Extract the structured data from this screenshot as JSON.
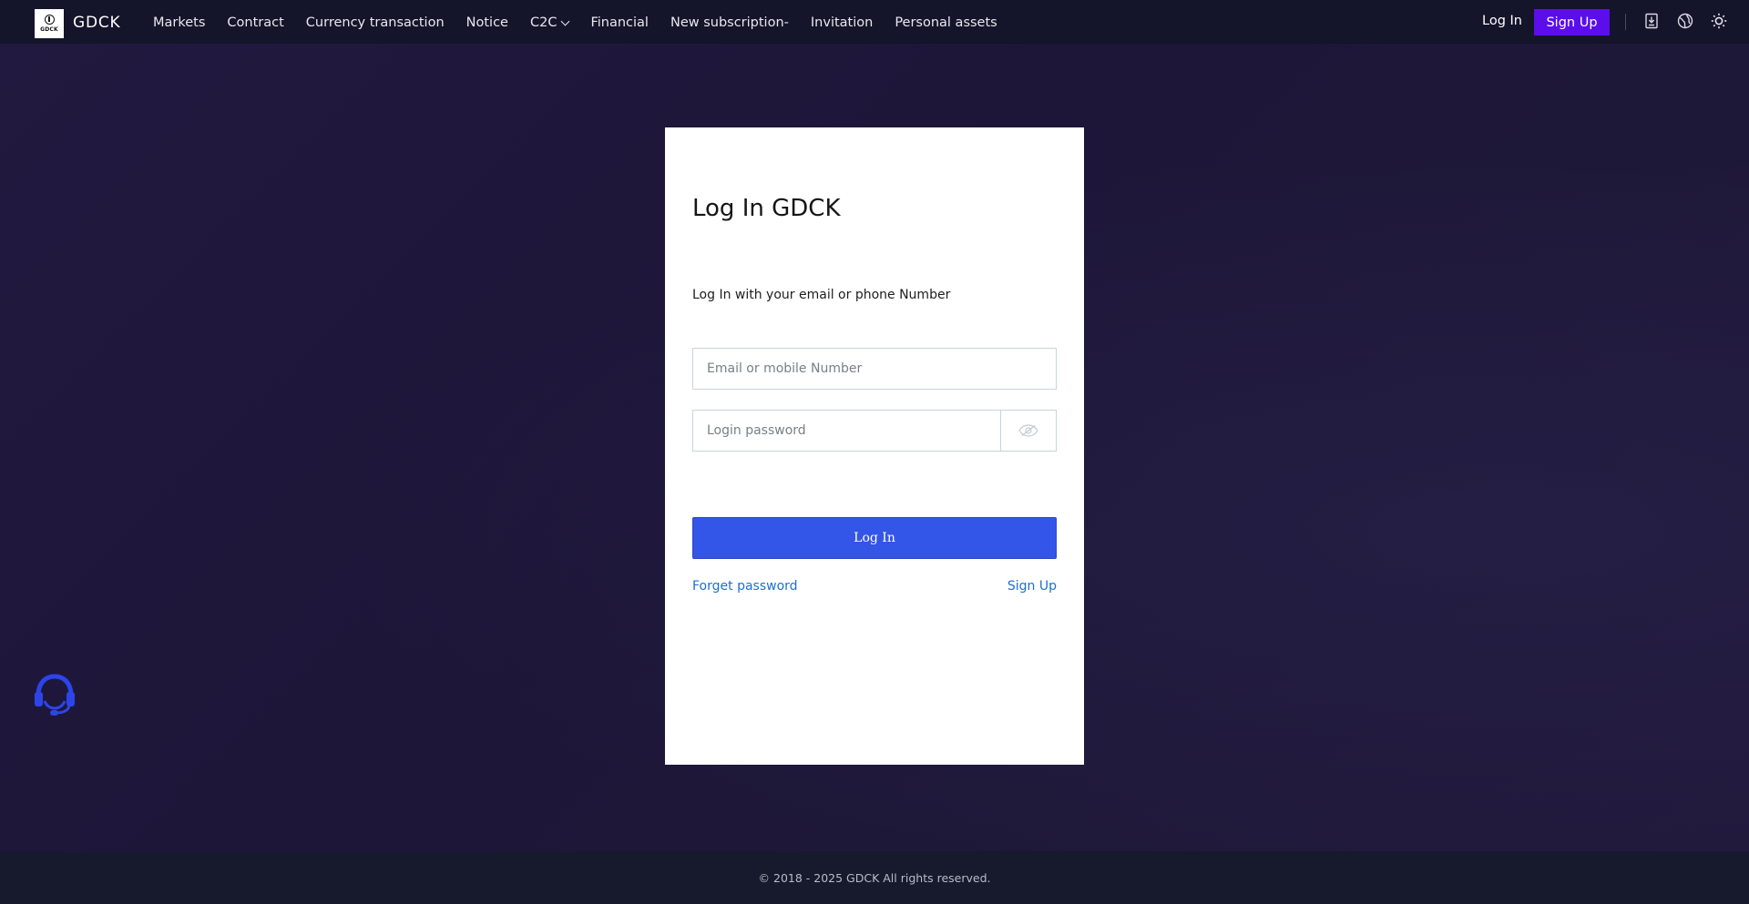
{
  "header": {
    "brand": "GDCK",
    "logo_text": "GDCK",
    "nav": [
      "Markets",
      "Contract",
      "Currency transaction",
      "Notice",
      "C2C",
      "Financial",
      "New subscription-",
      "Invitation",
      "Personal assets"
    ],
    "login_label": "Log In",
    "signup_label": "Sign Up",
    "icons": [
      "download-icon",
      "globe-icon",
      "sun-icon"
    ]
  },
  "login": {
    "title": "Log In GDCK",
    "subtitle": "Log In with your email or phone Number",
    "email_placeholder": "Email or mobile Number",
    "password_placeholder": "Login password",
    "submit_label": "Log In",
    "forget_label": "Forget password",
    "signup_label": "Sign Up"
  },
  "footer": {
    "copyright": "© 2018 - 2025 GDCK All rights reserved."
  },
  "colors": {
    "accent": "#5b0eeb",
    "button": "#3355e8",
    "link": "#1c6fd1",
    "background": "#1c1636"
  }
}
